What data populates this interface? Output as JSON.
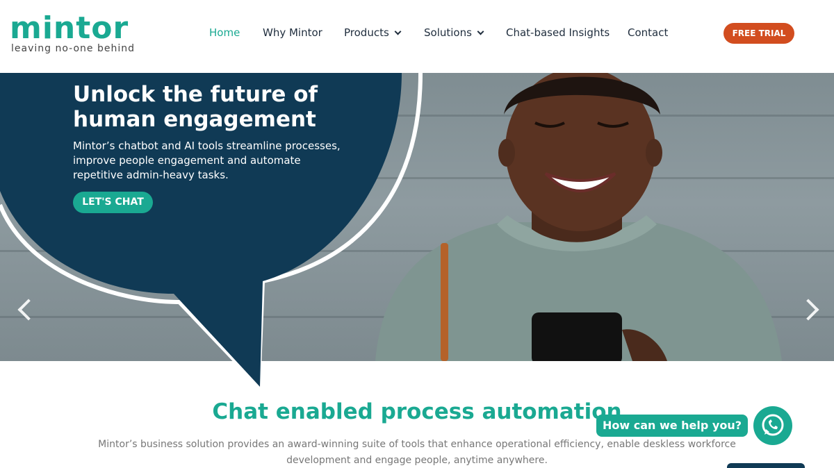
{
  "logo": {
    "word": "mintor",
    "tagline": "leaving no-one behind"
  },
  "nav": {
    "items": [
      {
        "label": "Home",
        "active": true
      },
      {
        "label": "Why Mintor"
      },
      {
        "label": "Products",
        "dropdown": true
      },
      {
        "label": "Solutions",
        "dropdown": true
      },
      {
        "label": "Chat-based Insights"
      },
      {
        "label": "Contact"
      }
    ],
    "trial_label": "FREE TRIAL"
  },
  "hero": {
    "title": "Unlock the future of human engagement",
    "description": "Mintor’s chatbot and AI tools streamline processes, improve people engagement and automate repetitive admin-heavy tasks.",
    "cta_label": "LET'S CHAT",
    "prev_icon": "chevron-left-icon",
    "next_icon": "chevron-right-icon"
  },
  "section": {
    "title": "Chat enabled process automation",
    "description": "Mintor’s business solution provides an award-winning suite of tools that enhance operational efficiency, enable deskless workforce development and engage people, anytime anywhere."
  },
  "widget": {
    "help_label": "How can we help you?",
    "icon": "whatsapp-icon"
  },
  "colors": {
    "brand_green": "#1aa992",
    "navy": "#103a55",
    "trial_orange": "#d24d1f"
  }
}
